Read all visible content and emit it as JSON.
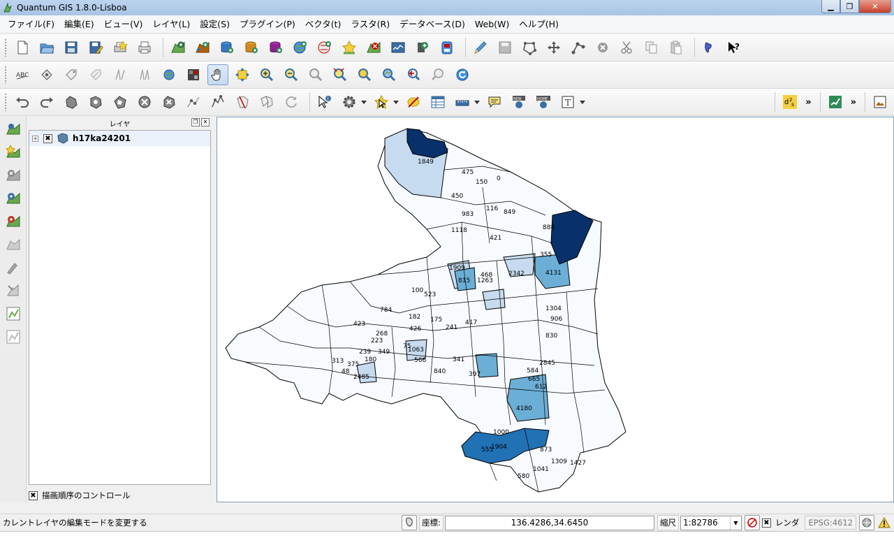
{
  "window": {
    "title": "Quantum GIS 1.8.0-Lisboa"
  },
  "menubar": {
    "items": [
      "ファイル(F)",
      "編集(E)",
      "ビュー(V)",
      "レイヤ(L)",
      "設定(S)",
      "プラグイン(P)",
      "ベクタ(t)",
      "ラスタ(R)",
      "データベース(D)",
      "Web(W)",
      "ヘルプ(H)"
    ]
  },
  "colors": {
    "class_lightest": "#f7fbff",
    "class_light": "#c6dbef",
    "class_mid": "#6baed6",
    "class_dark": "#2171b5",
    "class_darkest": "#08306b"
  },
  "layer_panel": {
    "title": "レイヤ",
    "layer_name": "h17ka24201",
    "layer_checked": "✖",
    "footer_label": "描画順序のコントロール",
    "footer_checked": "✖"
  },
  "map_labels": [
    "1849",
    "475",
    "150",
    "0",
    "450",
    "116",
    "849",
    "983",
    "1118",
    "421",
    "4131",
    "2342",
    "468",
    "1909",
    "815",
    "1263",
    "100",
    "523",
    "784",
    "423",
    "182",
    "426",
    "175",
    "417",
    "241",
    "268",
    "223",
    "239",
    "349",
    "75",
    "1063",
    "566",
    "341",
    "840",
    "313",
    "375",
    "48",
    "180",
    "2485",
    "397",
    "4180",
    "1304",
    "906",
    "830",
    "2845",
    "584",
    "665",
    "612",
    "1427",
    "1041",
    "580",
    "1309",
    "873",
    "1000",
    "1904",
    "555",
    "355",
    "888"
  ],
  "statusbar": {
    "message": "カレントレイヤの編集モードを変更する",
    "coord_label": "座標:",
    "coordinates": "136.4286,34.6450",
    "scale_label": "縮尺",
    "scale_value": "1:82786",
    "render_checked": "✖",
    "render_label": "レンダ",
    "epsg": "EPSG:4612"
  }
}
